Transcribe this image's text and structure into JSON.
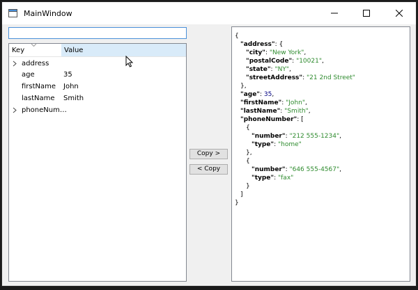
{
  "window": {
    "title": "MainWindow"
  },
  "search": {
    "value": ""
  },
  "tree": {
    "columns": {
      "key": "Key",
      "value": "Value"
    },
    "rows": [
      {
        "key": "address",
        "value": ""
      },
      {
        "key": "age",
        "value": "35"
      },
      {
        "key": "firstName",
        "value": "John"
      },
      {
        "key": "lastName",
        "value": "Smith"
      },
      {
        "key": "phoneNum…",
        "value": ""
      }
    ]
  },
  "buttons": {
    "copy_right": "Copy >",
    "copy_left": "< Copy"
  },
  "json": {
    "open": "{",
    "address_key": "\"address\"",
    "city_key": "\"city\"",
    "city_val": "\"New York\"",
    "postal_key": "\"postalCode\"",
    "postal_val": "\"10021\"",
    "state_key": "\"state\"",
    "state_val": "\"NY\"",
    "street_key": "\"streetAddress\"",
    "street_val": "\"21 2nd Street\"",
    "age_key": "\"age\"",
    "age_val": "35",
    "first_key": "\"firstName\"",
    "first_val": "\"John\"",
    "last_key": "\"lastName\"",
    "last_val": "\"Smith\"",
    "phone_key": "\"phoneNumber\"",
    "number_key": "\"number\"",
    "type_key": "\"type\"",
    "num1_val": "\"212 555-1234\"",
    "type1_val": "\"home\"",
    "num2_val": "\"646 555-4567\"",
    "type2_val": "\"fax\""
  }
}
